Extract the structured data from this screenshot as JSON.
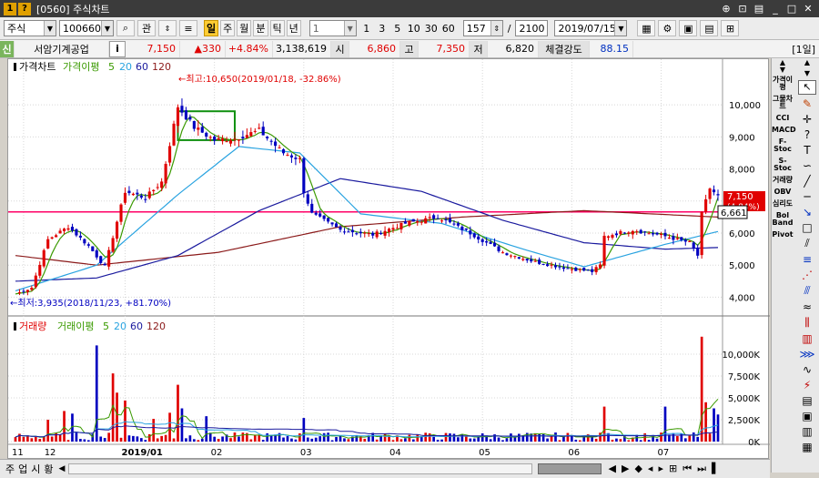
{
  "window": {
    "title": "[0560] 주식차트",
    "icon_a": "1",
    "icon_b": "?"
  },
  "toolbar": {
    "market": "주식",
    "code": "100660",
    "search_icon": "⌕",
    "related_label": "관",
    "period_buttons": [
      "일",
      "주",
      "월",
      "분",
      "틱",
      "년"
    ],
    "active_period": "일",
    "interval_value": "1",
    "interval_buttons": [
      "1",
      "3",
      "5",
      "10",
      "30",
      "60"
    ],
    "count_value": "157",
    "total_value": "2100",
    "date_value": "2019/07/15"
  },
  "quote": {
    "badge": "신",
    "name": "서암기계공업",
    "info_label": "i",
    "price": "7,150",
    "change": "▲330",
    "change_pct": "+4.84%",
    "volume": "3,138,619",
    "open_label": "시",
    "open": "6,860",
    "high_label": "고",
    "high": "7,350",
    "low_label": "저",
    "low": "6,820",
    "strength_label": "체결강도",
    "strength": "88.15",
    "period_tag": "[1일]"
  },
  "price_panel": {
    "legend_title": "가격차트",
    "legend_ma_label": "가격이평",
    "legend_ma_values": [
      "5",
      "20",
      "60",
      "120"
    ],
    "high_annotation": "←최고:10,650(2019/01/18, -32.86%)",
    "low_annotation": "←최저:3,935(2018/11/23, +81.70%)",
    "y_ticks": [
      "10,000",
      "9,000",
      "8,000",
      "7,000",
      "6,000",
      "5,000",
      "4,000"
    ],
    "current_price_tag": "7,150",
    "current_change_tag": "(4.84%)",
    "hline_tag": "6,661"
  },
  "volume_panel": {
    "legend_title": "거래량",
    "legend_ma_label": "거래이평",
    "legend_ma_values": [
      "5",
      "20",
      "60",
      "120"
    ],
    "y_ticks": [
      "10,000K",
      "7,500K",
      "5,000K",
      "2,500K",
      "0K"
    ]
  },
  "x_axis": {
    "labels": [
      "11",
      "12",
      "2019/01",
      "02",
      "03",
      "04",
      "05",
      "06",
      "07"
    ]
  },
  "right_panel": {
    "indicators": [
      "가격이평",
      "그물차트",
      "CCI",
      "MACD",
      "F-Stoc",
      "S-Stoc",
      "거래량",
      "OBV",
      "심리도",
      "Bol Band",
      "Pivot"
    ]
  },
  "bottom_bar": {
    "tabs": [
      "주",
      "업",
      "시",
      "황"
    ]
  },
  "colors": {
    "up": "#e00000",
    "down": "#0000c0",
    "ma5": "#3a9a00",
    "ma20": "#29a3e0",
    "ma60": "#1a1a9e",
    "ma120": "#8b1a1a",
    "hline": "#ff0066"
  },
  "chart_data": {
    "type": "candlestick",
    "price_axis": {
      "ylim": [
        3700,
        10800
      ],
      "ticks": [
        4000,
        5000,
        6000,
        7000,
        8000,
        9000,
        10000
      ]
    },
    "volume_axis": {
      "ylim": [
        0,
        12500000
      ],
      "ticks": [
        0,
        2500000,
        5000000,
        7500000,
        10000000
      ]
    },
    "horizontal_line": 6661,
    "highlight_box": {
      "from_index": 40,
      "to_index": 54,
      "low": 8900,
      "high": 9800
    },
    "months": [
      "2018/11",
      "2018/12",
      "2019/01",
      "2019/02",
      "2019/03",
      "2019/04",
      "2019/05",
      "2019/06",
      "2019/07"
    ],
    "anchors": [
      {
        "i": 0,
        "c": 4100
      },
      {
        "i": 4,
        "c": 4300
      },
      {
        "i": 8,
        "c": 5800
      },
      {
        "i": 13,
        "c": 6200
      },
      {
        "i": 18,
        "c": 5600
      },
      {
        "i": 22,
        "c": 4950
      },
      {
        "i": 27,
        "c": 7300
      },
      {
        "i": 32,
        "c": 7100
      },
      {
        "i": 36,
        "c": 7600
      },
      {
        "i": 40,
        "c": 9950
      },
      {
        "i": 44,
        "c": 9300
      },
      {
        "i": 49,
        "c": 8900
      },
      {
        "i": 54,
        "c": 8950
      },
      {
        "i": 60,
        "c": 9200
      },
      {
        "i": 66,
        "c": 8500
      },
      {
        "i": 70,
        "c": 8300
      },
      {
        "i": 71,
        "c": 7300
      },
      {
        "i": 73,
        "c": 6600
      },
      {
        "i": 80,
        "c": 6100
      },
      {
        "i": 88,
        "c": 5950
      },
      {
        "i": 96,
        "c": 6300
      },
      {
        "i": 104,
        "c": 6500
      },
      {
        "i": 112,
        "c": 6000
      },
      {
        "i": 120,
        "c": 5400
      },
      {
        "i": 128,
        "c": 5100
      },
      {
        "i": 136,
        "c": 4900
      },
      {
        "i": 142,
        "c": 4800
      },
      {
        "i": 144,
        "c": 5000
      },
      {
        "i": 145,
        "c": 5900
      },
      {
        "i": 152,
        "c": 6100
      },
      {
        "i": 160,
        "c": 5900
      },
      {
        "i": 166,
        "c": 5700
      },
      {
        "i": 168,
        "c": 5300
      },
      {
        "i": 169,
        "c": 6600
      },
      {
        "i": 171,
        "c": 7400
      },
      {
        "i": 173,
        "c": 7150
      }
    ],
    "ma": {
      "ma20": [
        {
          "i": 0,
          "v": 4200
        },
        {
          "i": 20,
          "v": 5000
        },
        {
          "i": 40,
          "v": 7200
        },
        {
          "i": 55,
          "v": 8700
        },
        {
          "i": 70,
          "v": 8500
        },
        {
          "i": 85,
          "v": 6600
        },
        {
          "i": 105,
          "v": 6300
        },
        {
          "i": 125,
          "v": 5500
        },
        {
          "i": 140,
          "v": 4950
        },
        {
          "i": 160,
          "v": 5650
        },
        {
          "i": 173,
          "v": 6050
        }
      ],
      "ma60": [
        {
          "i": 0,
          "v": 4500
        },
        {
          "i": 20,
          "v": 4600
        },
        {
          "i": 40,
          "v": 5300
        },
        {
          "i": 60,
          "v": 6700
        },
        {
          "i": 80,
          "v": 7700
        },
        {
          "i": 100,
          "v": 7300
        },
        {
          "i": 120,
          "v": 6400
        },
        {
          "i": 140,
          "v": 5700
        },
        {
          "i": 160,
          "v": 5500
        },
        {
          "i": 173,
          "v": 5550
        }
      ],
      "ma120": [
        {
          "i": 0,
          "v": 5300
        },
        {
          "i": 20,
          "v": 5000
        },
        {
          "i": 50,
          "v": 5400
        },
        {
          "i": 80,
          "v": 6200
        },
        {
          "i": 110,
          "v": 6500
        },
        {
          "i": 140,
          "v": 6700
        },
        {
          "i": 173,
          "v": 6500
        }
      ]
    },
    "volume_spikes": [
      {
        "i": 8,
        "v": 2500000
      },
      {
        "i": 12,
        "v": 3500000
      },
      {
        "i": 14,
        "v": 3200000
      },
      {
        "i": 20,
        "v": 11000000
      },
      {
        "i": 24,
        "v": 7800000
      },
      {
        "i": 25,
        "v": 5600000
      },
      {
        "i": 27,
        "v": 4700000
      },
      {
        "i": 34,
        "v": 2600000
      },
      {
        "i": 38,
        "v": 3300000
      },
      {
        "i": 40,
        "v": 6500000
      },
      {
        "i": 41,
        "v": 3800000
      },
      {
        "i": 47,
        "v": 2900000
      },
      {
        "i": 71,
        "v": 2700000
      },
      {
        "i": 145,
        "v": 4000000
      },
      {
        "i": 160,
        "v": 4000000
      },
      {
        "i": 169,
        "v": 12000000
      },
      {
        "i": 170,
        "v": 4500000
      },
      {
        "i": 172,
        "v": 3800000
      },
      {
        "i": 173,
        "v": 3100000
      }
    ]
  }
}
